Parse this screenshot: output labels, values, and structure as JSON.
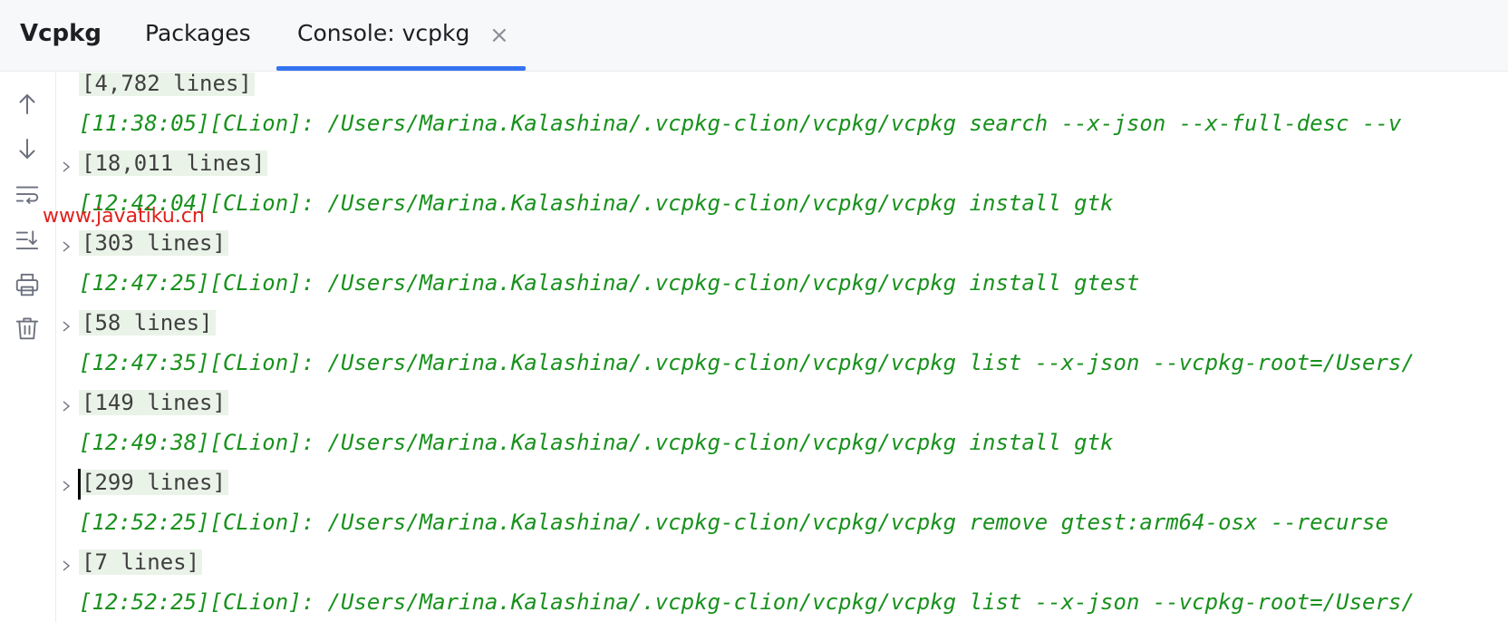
{
  "header": {
    "title": "Vcpkg",
    "tabs": [
      {
        "label": "Packages"
      },
      {
        "label": "Console: vcpkg"
      }
    ],
    "close_glyph": "×"
  },
  "toolbar": {
    "icons": [
      "arrow-up-icon",
      "arrow-down-icon",
      "soft-wrap-icon",
      "scroll-to-end-icon",
      "print-icon",
      "trash-icon"
    ]
  },
  "watermark": "www.javatiku.cn",
  "console": {
    "lines": [
      {
        "kind": "fold",
        "text": "[4,782 lines]"
      },
      {
        "kind": "cmd",
        "text": "[11:38:05][CLion]: /Users/Marina.Kalashina/.vcpkg-clion/vcpkg/vcpkg search --x-json --x-full-desc --v"
      },
      {
        "kind": "fold",
        "text": "[18,011 lines]"
      },
      {
        "kind": "cmd",
        "text": "[12:42:04][CLion]: /Users/Marina.Kalashina/.vcpkg-clion/vcpkg/vcpkg install gtk"
      },
      {
        "kind": "fold",
        "text": "[303 lines]"
      },
      {
        "kind": "cmd",
        "text": "[12:47:25][CLion]: /Users/Marina.Kalashina/.vcpkg-clion/vcpkg/vcpkg install gtest"
      },
      {
        "kind": "fold",
        "text": "[58 lines]"
      },
      {
        "kind": "cmd",
        "text": "[12:47:35][CLion]: /Users/Marina.Kalashina/.vcpkg-clion/vcpkg/vcpkg list --x-json --vcpkg-root=/Users/"
      },
      {
        "kind": "fold",
        "text": "[149 lines]"
      },
      {
        "kind": "cmd",
        "text": "[12:49:38][CLion]: /Users/Marina.Kalashina/.vcpkg-clion/vcpkg/vcpkg install gtk"
      },
      {
        "kind": "fold",
        "text": "[299 lines]"
      },
      {
        "kind": "cmd",
        "text": "[12:52:25][CLion]: /Users/Marina.Kalashina/.vcpkg-clion/vcpkg/vcpkg remove gtest:arm64-osx --recurse"
      },
      {
        "kind": "fold",
        "text": "[7 lines]"
      },
      {
        "kind": "cmd",
        "text": "[12:52:25][CLion]: /Users/Marina.Kalashina/.vcpkg-clion/vcpkg/vcpkg list --x-json --vcpkg-root=/Users/"
      }
    ]
  },
  "colors": {
    "accent": "#3574f0",
    "command_text": "#18911d",
    "fold_background": "#eaf3e8"
  }
}
